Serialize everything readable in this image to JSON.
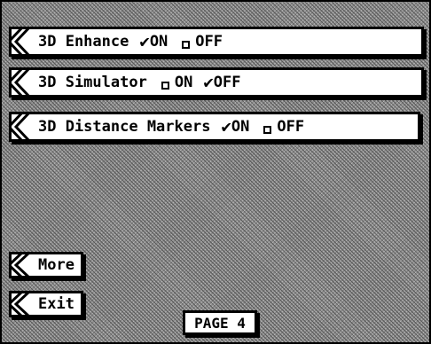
{
  "menu": [
    {
      "label": "3D Enhance",
      "checked_state": "ON",
      "options": {
        "on": "ON",
        "off": "OFF"
      }
    },
    {
      "label": "3D Simulator",
      "checked_state": "OFF",
      "options": {
        "on": "ON",
        "off": "OFF"
      }
    },
    {
      "label": "3D Distance Markers",
      "checked_state": "ON",
      "options": {
        "on": "ON",
        "off": "OFF"
      }
    }
  ],
  "buttons": {
    "more": "More",
    "exit": "Exit"
  },
  "page_indicator": "PAGE 4",
  "icons": {
    "check": "check-icon",
    "box": "empty-checkbox-icon",
    "arrow": "left-arrow-tab-icon"
  }
}
